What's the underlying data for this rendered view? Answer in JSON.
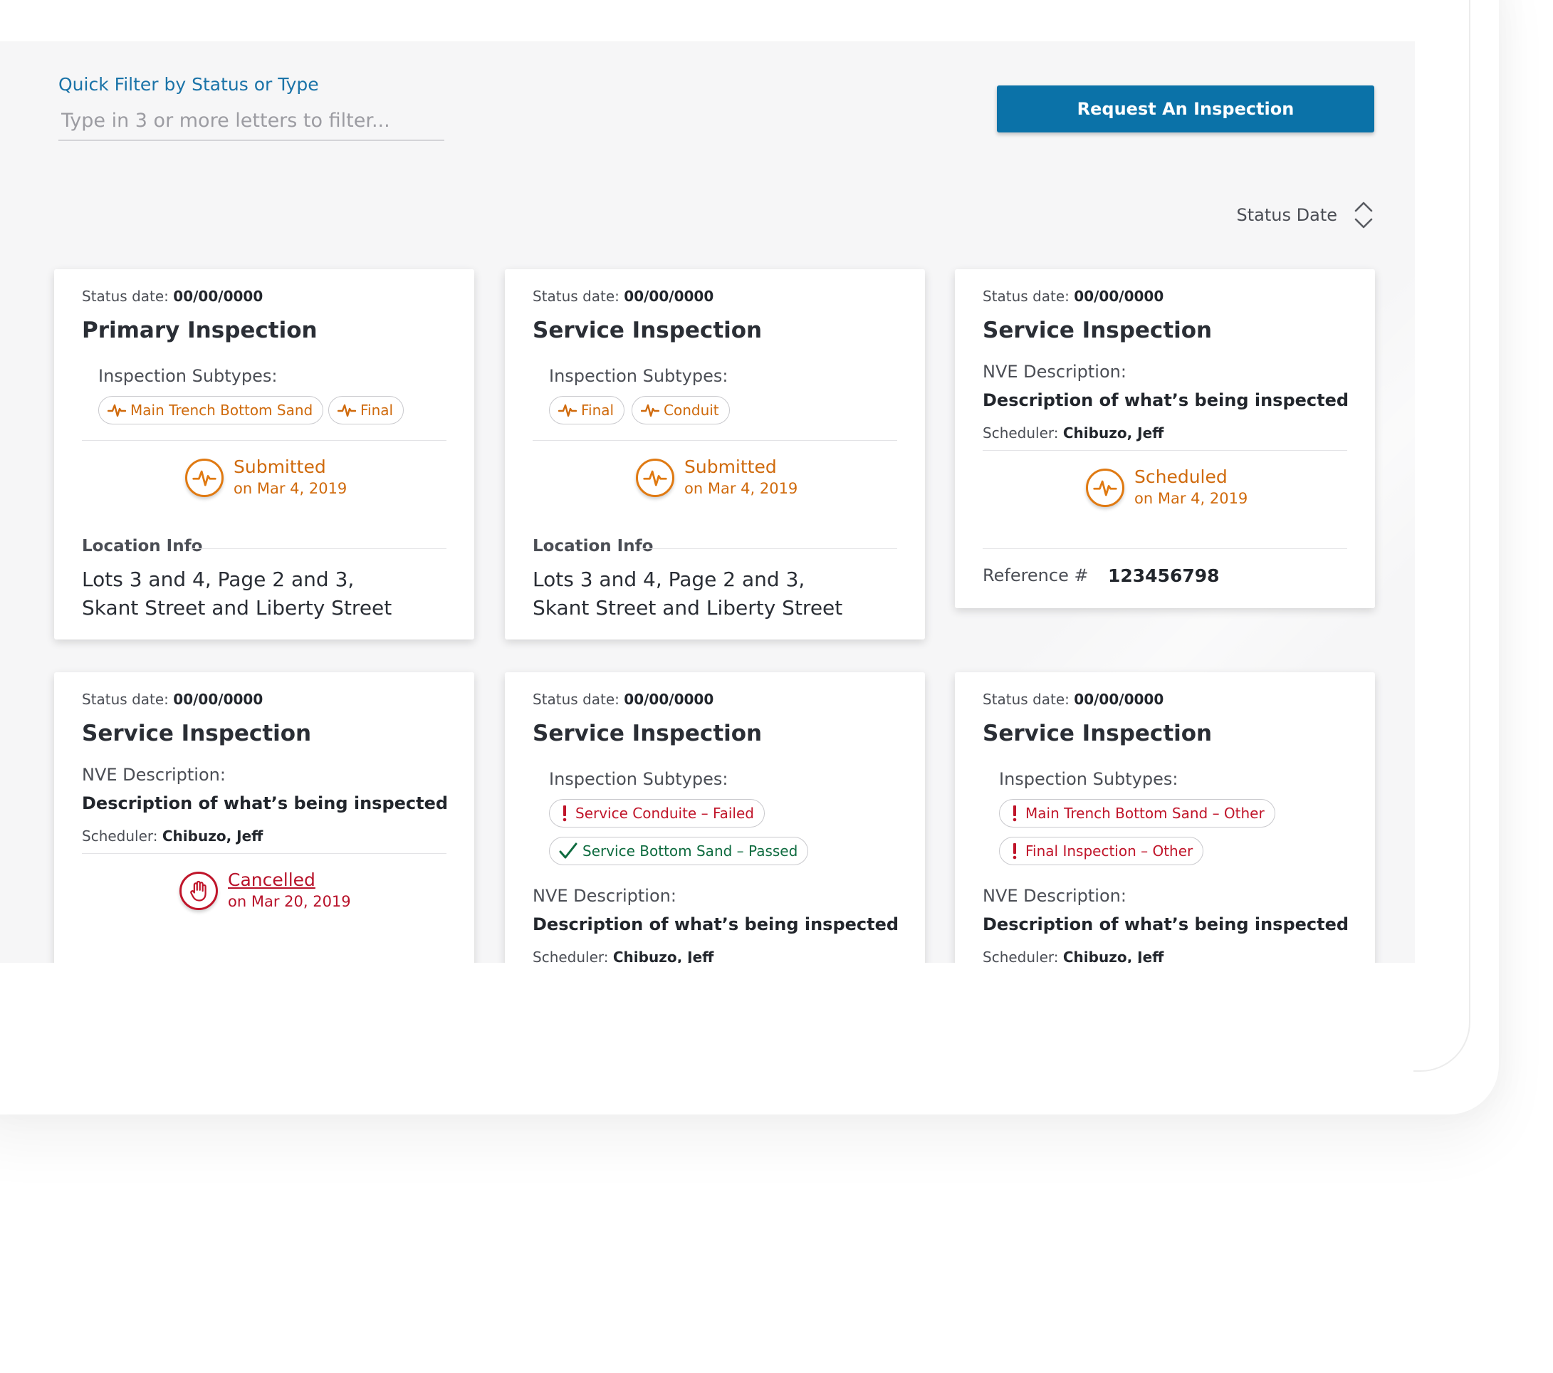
{
  "filter": {
    "label": "Quick Filter by Status or Type",
    "placeholder": "Type in 3 or more letters to filter...",
    "value": ""
  },
  "request_button": {
    "label": "Request An Inspection"
  },
  "sort": {
    "label": "Status Date"
  },
  "colors": {
    "accent": "#0b72a8",
    "submitted": "#d06a0c",
    "cancelled": "#b8122a",
    "passed": "#0e6b3f"
  },
  "cards": [
    {
      "status_date_label": "Status date:",
      "status_date": "00/00/0000",
      "title": "Primary Inspection",
      "subtypes_label": "Inspection Subtypes:",
      "subtypes": [
        {
          "label": "Main Trench Bottom Sand",
          "icon": "pulse-icon"
        },
        {
          "label": "Final",
          "icon": "pulse-icon"
        }
      ],
      "status": "Submitted",
      "status_on": "on Mar 4, 2019",
      "location_label": "Location Info",
      "location": "Lots 3 and 4, Page 2 and 3, Skant Street and Liberty Street"
    },
    {
      "status_date_label": "Status date:",
      "status_date": "00/00/0000",
      "title": "Service Inspection",
      "subtypes_label": "Inspection Subtypes:",
      "subtypes": [
        {
          "label": "Final",
          "icon": "pulse-icon"
        },
        {
          "label": "Conduit",
          "icon": "pulse-icon"
        }
      ],
      "status": "Submitted",
      "status_on": "on Mar 4, 2019",
      "location_label": "Location Info",
      "location": "Lots 3 and 4, Page 2 and 3, Skant Street and Liberty Street"
    },
    {
      "status_date_label": "Status date:",
      "status_date": "00/00/0000",
      "title": "Service Inspection",
      "nve_label": "NVE Description:",
      "nve_desc": "Description of what’s being inspected",
      "scheduler_label": "Scheduler:",
      "scheduler": "Chibuzo, Jeff",
      "status": "Scheduled",
      "status_on": "on Mar 4, 2019",
      "reference_label": "Reference #",
      "reference": "123456798"
    },
    {
      "status_date_label": "Status date:",
      "status_date": "00/00/0000",
      "title": "Service Inspection",
      "nve_label": "NVE Description:",
      "nve_desc": "Description of what’s being inspected",
      "scheduler_label": "Scheduler:",
      "scheduler": "Chibuzo, Jeff",
      "status": "Cancelled",
      "status_on": "on Mar 20, 2019"
    },
    {
      "status_date_label": "Status date:",
      "status_date": "00/00/0000",
      "title": "Service Inspection",
      "subtypes_label": "Inspection Subtypes:",
      "subtypes": [
        {
          "label": "Service Conduite – Failed",
          "icon": "exclamation-icon"
        },
        {
          "label": "Service Bottom Sand – Passed",
          "icon": "check-icon"
        }
      ],
      "nve_label": "NVE Description:",
      "nve_desc": "Description of what’s being inspected",
      "scheduler_label": "Scheduler:",
      "scheduler": "Chibuzo, Jeff"
    },
    {
      "status_date_label": "Status date:",
      "status_date": "00/00/0000",
      "title": "Service Inspection",
      "subtypes_label": "Inspection Subtypes:",
      "subtypes": [
        {
          "label": "Main Trench Bottom Sand – Other",
          "icon": "exclamation-icon"
        },
        {
          "label": "Final Inspection – Other",
          "icon": "exclamation-icon"
        }
      ],
      "nve_label": "NVE Description:",
      "nve_desc": "Description of what’s being inspected",
      "scheduler_label": "Scheduler:",
      "scheduler": "Chibuzo, Jeff"
    }
  ]
}
